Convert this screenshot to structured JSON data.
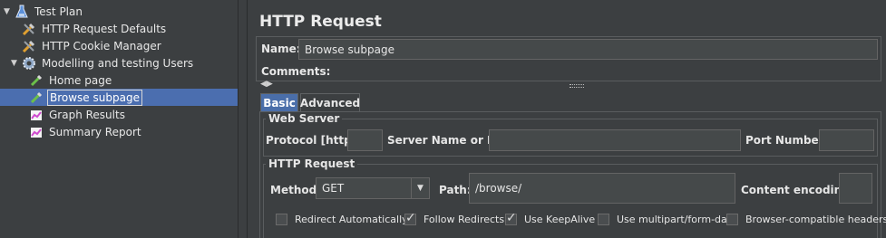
{
  "tree": {
    "items": [
      {
        "label": "Test Plan",
        "icon": "flask-icon",
        "toggle": "▼"
      },
      {
        "label": "HTTP Request Defaults",
        "icon": "wrench-icon"
      },
      {
        "label": "HTTP Cookie Manager",
        "icon": "wrench-icon"
      },
      {
        "label": "Modelling and testing Users",
        "icon": "gear-icon",
        "toggle": "▼"
      },
      {
        "label": "Home page",
        "icon": "pipette-icon"
      },
      {
        "label": "Browse subpage",
        "icon": "pipette-icon",
        "selected": true
      },
      {
        "label": "Graph Results",
        "icon": "chart-icon"
      },
      {
        "label": "Summary Report",
        "icon": "chart-icon"
      }
    ]
  },
  "panel": {
    "title": "HTTP Request",
    "name_label": "Name:",
    "name_value": "Browse subpage",
    "comments_label": "Comments:",
    "tabs": [
      {
        "label": "Basic",
        "active": true
      },
      {
        "label": "Advanced",
        "active": false
      }
    ],
    "web_server": {
      "title": "Web Server",
      "protocol_label": "Protocol [http]:",
      "protocol_value": "",
      "server_label": "Server Name or IP:",
      "server_value": "",
      "port_label": "Port Number:",
      "port_value": ""
    },
    "http_request": {
      "title": "HTTP Request",
      "method_label": "Method:",
      "method_value": "GET",
      "path_label": "Path:",
      "path_value": "/browse/",
      "encoding_label": "Content encoding:",
      "encoding_value": ""
    },
    "options": [
      {
        "label": "Redirect Automatically",
        "checked": false
      },
      {
        "label": "Follow Redirects",
        "checked": true
      },
      {
        "label": "Use KeepAlive",
        "checked": true
      },
      {
        "label": "Use multipart/form-data",
        "checked": false
      },
      {
        "label": "Browser-compatible headers",
        "checked": false
      }
    ]
  },
  "colors": {
    "selection": "#4b6eaf",
    "background": "#3c3f41",
    "active_tab": "#4a6ea9"
  }
}
